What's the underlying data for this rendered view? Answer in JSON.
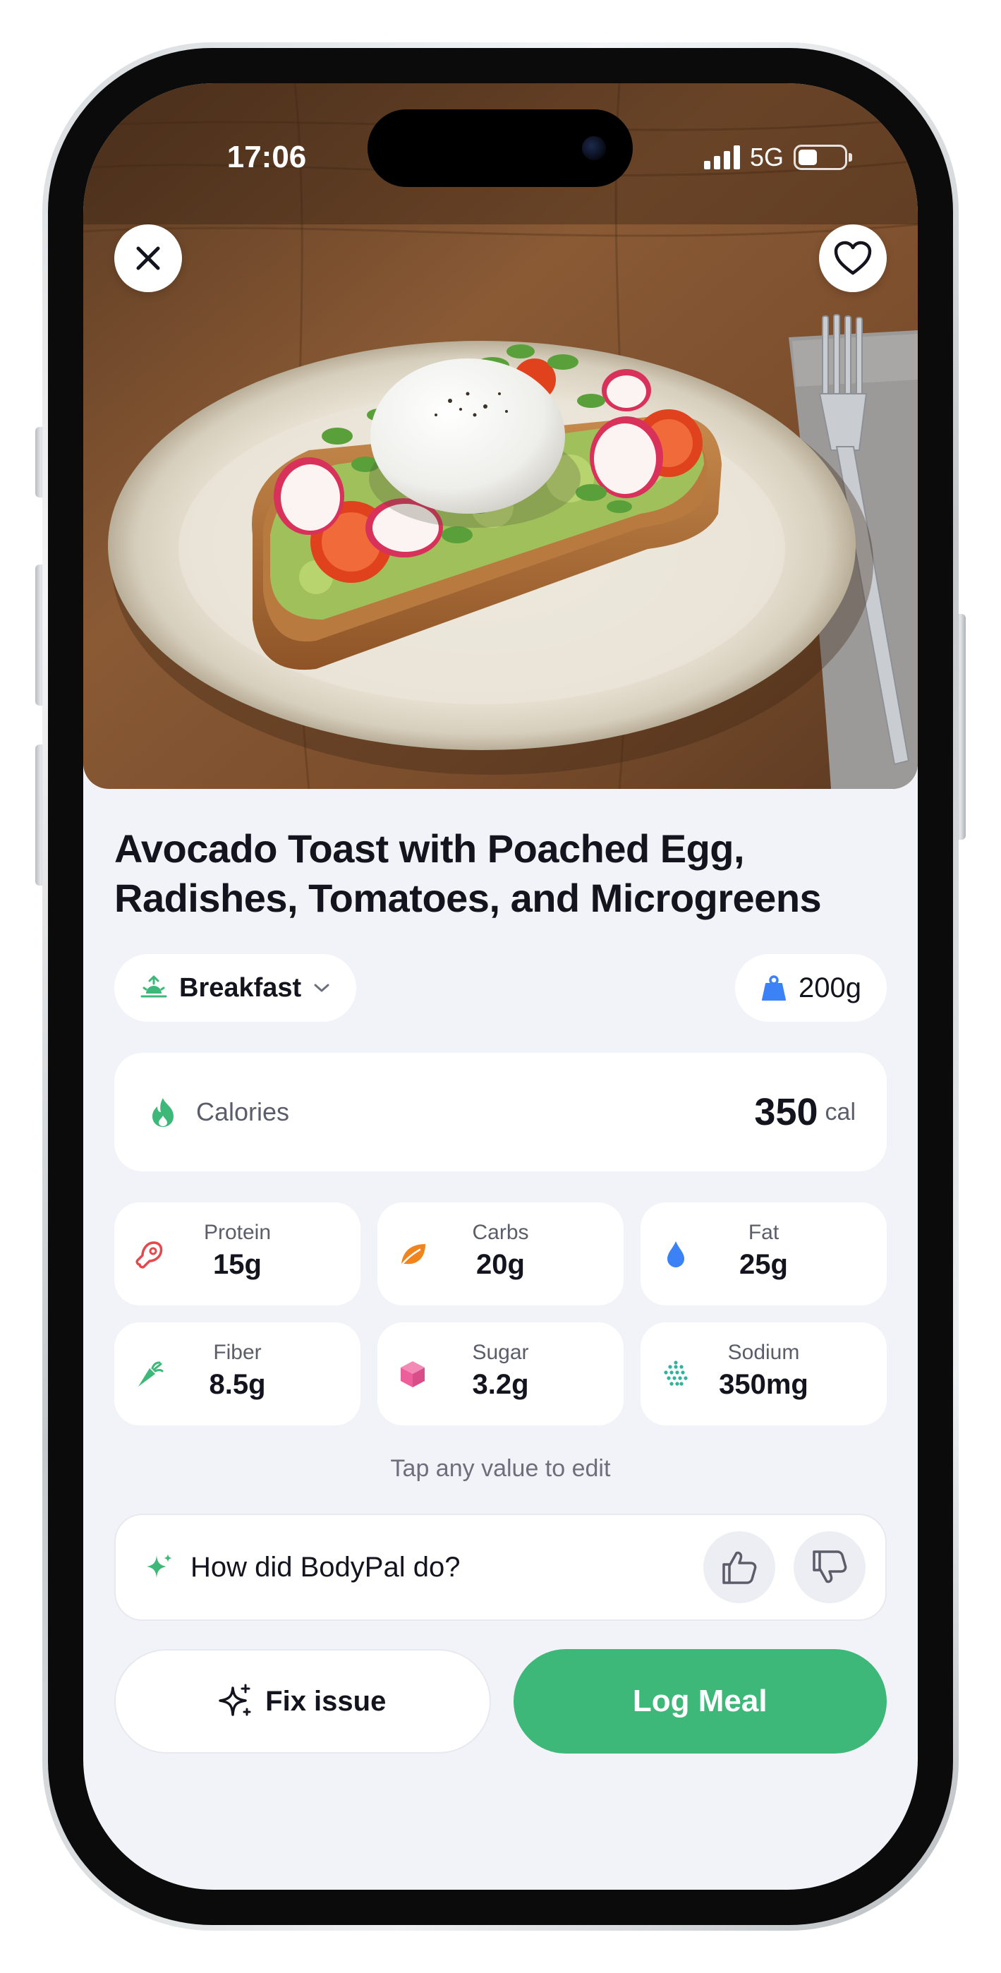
{
  "status_bar": {
    "time": "17:06",
    "network": "5G",
    "battery_level": 0.42
  },
  "meal": {
    "title": "Avocado Toast with Poached Egg, Radishes, Tomatoes, and Microgreens",
    "meal_type": "Breakfast",
    "weight": "200g"
  },
  "calories": {
    "label": "Calories",
    "value": "350",
    "unit": "cal"
  },
  "nutrients": [
    {
      "name": "Protein",
      "value": "15g",
      "icon": "meat-icon",
      "color": "#e5484d"
    },
    {
      "name": "Carbs",
      "value": "20g",
      "icon": "leaf-icon",
      "color": "#f0851e"
    },
    {
      "name": "Fat",
      "value": "25g",
      "icon": "droplet-icon",
      "color": "#3b82f6"
    },
    {
      "name": "Fiber",
      "value": "8.5g",
      "icon": "carrot-icon",
      "color": "#3db878"
    },
    {
      "name": "Sugar",
      "value": "3.2g",
      "icon": "cube-icon",
      "color": "#ec5f9a"
    },
    {
      "name": "Sodium",
      "value": "350mg",
      "icon": "salt-dots-icon",
      "color": "#2fb39a"
    }
  ],
  "hint": "Tap any value to edit",
  "feedback": {
    "question": "How did BodyPal do?"
  },
  "actions": {
    "fix": "Fix issue",
    "log": "Log Meal"
  },
  "colors": {
    "accent": "#3db878",
    "background": "#f2f3f8",
    "text": "#14141f"
  }
}
